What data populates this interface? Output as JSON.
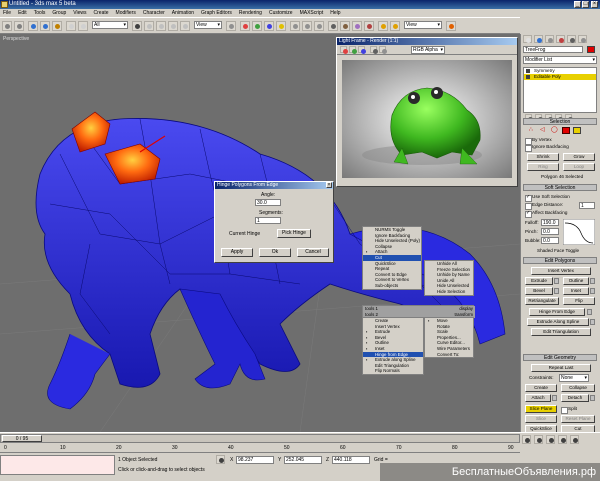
{
  "app": {
    "title": "Untitled - 3ds max 5 beta"
  },
  "menu": [
    "File",
    "Edit",
    "Tools",
    "Group",
    "Views",
    "Create",
    "Modifiers",
    "Character",
    "Animation",
    "Graph Editors",
    "Rendering",
    "Customize",
    "MAXScript",
    "Help"
  ],
  "toolbar": {
    "selection_filter": "All",
    "coord_system": "View",
    "named_sel": "View"
  },
  "viewport": {
    "label": "Perspective"
  },
  "render_window": {
    "title": "Light Frame - Render (1:1)",
    "channel": "RGB Alpha"
  },
  "hinge_dialog": {
    "title": "Hinge Polygons From Edge",
    "angle_label": "Angle:",
    "angle_value": "30.0",
    "segments_label": "Segments:",
    "segments_value": "1",
    "current_hinge_label": "Current Hinge",
    "pick_hinge": "Pick Hinge",
    "apply": "Apply",
    "ok": "Ok",
    "cancel": "Cancel"
  },
  "quad_menu": {
    "top_left": [
      "NURMS Toggle",
      "Ignore Backfacing",
      "Hide Unselected (Poly)",
      "Collapse",
      "Attach",
      "Cut",
      "QuickSlice",
      "Repeat",
      "Convert to Edge",
      "Convert to Vertex",
      "Sub-objects"
    ],
    "top_right": [
      "Unhide All",
      "Freeze Selection",
      "Unhide by Name",
      "Unide All",
      "Hide Unselected",
      "Hide Selection"
    ],
    "header_left": "tools 1",
    "header_right": "display",
    "header_left2": "tools 2",
    "header_right2": "transform",
    "bottom_left": [
      "Create",
      "Insert Vertex",
      "Extrude",
      "Bevel",
      "Outline",
      "Inset",
      "Hinge from Edge",
      "Extrude along Spline",
      "Edit Triangulation",
      "Flip Normals"
    ],
    "bottom_right": [
      "Move",
      "Rotate",
      "Scale",
      "Properties...",
      "Curve Editor...",
      "Wire Parameters",
      "Convert To:"
    ]
  },
  "command_panel": {
    "object_name": "TreeFrog",
    "modifier_list": "Modifier List",
    "stack": [
      "Symmetry",
      "Editable Poly"
    ],
    "selection_rollout": "Selection",
    "by_vertex": "By Vertex",
    "ignore_backfacing": "Ignore Backfacing",
    "shrink": "Shrink",
    "grow": "Grow",
    "ring": "Ring",
    "loop": "Loop",
    "selected_count": "Polygon 46 Selected",
    "soft_selection": "Soft Selection",
    "use_soft_selection": "Use Soft Selection",
    "edge_distance": "Edge Distance:",
    "edge_distance_value": "1",
    "affect_backfacing": "Affect Backfacing",
    "falloff_label": "Falloff:",
    "falloff_value": "190.0",
    "pinch_label": "Pinch:",
    "pinch_value": "0.0",
    "bubble_label": "Bubble:",
    "bubble_value": "0.0",
    "shaded_face_toggle": "Shaded Face Toggle",
    "edit_polygons": "Edit Polygons",
    "insert_vertex": "Insert Vertex",
    "extrude": "Extrude",
    "outline": "Outline",
    "bevel": "Bevel",
    "inset": "Inset",
    "retriangulate": "Retriangulate",
    "flip": "Flip",
    "hinge_from_edge": "Hinge From Edge",
    "extrude_along_spline": "Extrude Along Spline",
    "edit_triangulation": "Edit Triangulation",
    "edit_geometry": "Edit Geometry",
    "repeat_last": "Repeat Last",
    "constraints_label": "Constraints:",
    "constraints_value": "None",
    "create": "Create",
    "collapse": "Collapse",
    "attach": "Attach",
    "detach": "Detach",
    "slice_plane": "Slice Plane",
    "split": "Split",
    "slice": "Slice",
    "reset_plane": "Reset Plane",
    "quickslice": "QuickSlice",
    "cut": "Cut",
    "msmooth": "MSmooth",
    "tessellate": "Tessellate"
  },
  "status": {
    "time_slider": "0 / 95",
    "objects_selected": "1 Object Selected",
    "prompt": "Click or click-and-drag to select objects",
    "x_label": "X",
    "x_value": "98.237",
    "y_label": "Y",
    "y_value": "252.045",
    "z_label": "Z",
    "z_value": "440.118",
    "grid_label": "Grid =",
    "ruler": [
      "0",
      "10",
      "20",
      "30",
      "40",
      "50",
      "60",
      "70",
      "80",
      "90"
    ]
  },
  "watermark": "БесплатныеОбъявления.рф",
  "colors": {
    "frog_blue": "#2a2ae0",
    "highlight_orange": "#ff6a10",
    "frog_green": "#3fb820",
    "selection_red": "#e00000"
  }
}
